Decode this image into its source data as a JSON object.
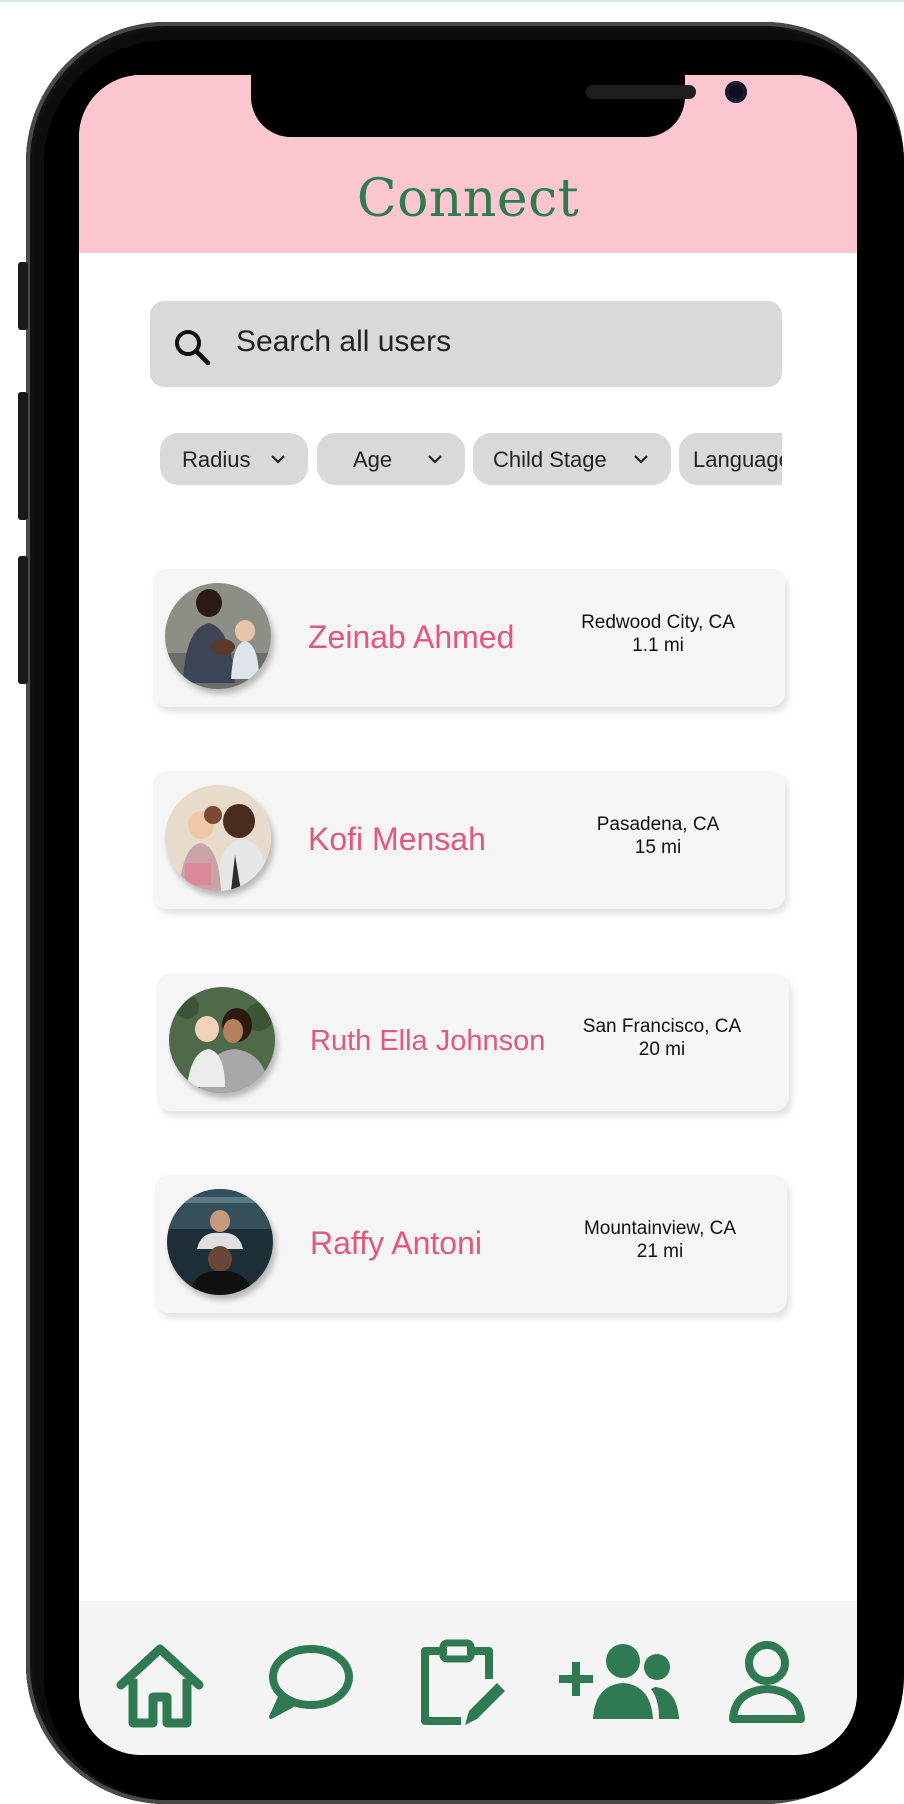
{
  "colors": {
    "header_bg": "#fbc6d0",
    "brand_green": "#2f7a53",
    "name_pink": "#e0587a",
    "search_bg": "#d9d9d9",
    "card_bg": "#f5f5f5"
  },
  "header": {
    "title": "Connect"
  },
  "search": {
    "placeholder": "Search all users",
    "icon": "search-icon"
  },
  "filters": [
    {
      "label": "Radius",
      "icon": "chevron-down-icon"
    },
    {
      "label": "Age",
      "icon": "chevron-down-icon"
    },
    {
      "label": "Child Stage",
      "icon": "chevron-down-icon"
    },
    {
      "label": "Language",
      "icon": "chevron-down-icon"
    }
  ],
  "users": [
    {
      "name": "Zeinab Ahmed",
      "location": "Redwood City, CA",
      "distance": "1.1 mi"
    },
    {
      "name": "Kofi Mensah",
      "location": "Pasadena, CA",
      "distance": "15 mi"
    },
    {
      "name": "Ruth Ella Johnson",
      "location": "San Francisco, CA",
      "distance": "20 mi"
    },
    {
      "name": "Raffy Antoni",
      "location": "Mountainview, CA",
      "distance": "21 mi"
    }
  ],
  "nav": [
    {
      "icon": "home-icon"
    },
    {
      "icon": "chat-bubble-icon"
    },
    {
      "icon": "clipboard-edit-icon"
    },
    {
      "icon": "add-group-icon"
    },
    {
      "icon": "profile-icon"
    }
  ]
}
